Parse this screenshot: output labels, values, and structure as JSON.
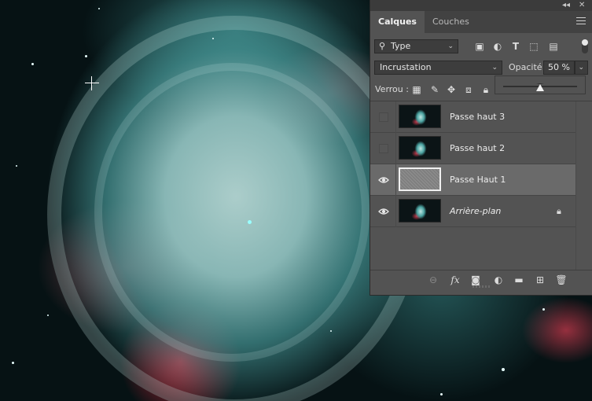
{
  "panel": {
    "topstrip": {
      "collapse_glyph": "◂◂",
      "close_glyph": "✕"
    },
    "tabs": [
      {
        "label": "Calques",
        "active": true
      },
      {
        "label": "Couches",
        "active": false
      }
    ],
    "filter": {
      "kind_label": "Type",
      "icons": [
        "image-filter-icon",
        "adjustment-filter-icon",
        "text-filter-icon",
        "shape-filter-icon",
        "smart-object-filter-icon"
      ]
    },
    "blend": {
      "mode": "Incrustation",
      "opacity_label": "Opacité :",
      "opacity_value": "50 %"
    },
    "lock": {
      "label": "Verrou :",
      "icons": [
        "lock-transparent-icon",
        "lock-image-icon",
        "lock-position-icon",
        "lock-artboard-icon",
        "lock-all-icon"
      ]
    },
    "opacity_slider": {
      "value_percent": 50
    },
    "layers": [
      {
        "name": "Passe haut 3",
        "visible": false,
        "selected": false,
        "thumb": "nebula",
        "locked": false,
        "italic": false
      },
      {
        "name": "Passe haut 2",
        "visible": false,
        "selected": false,
        "thumb": "nebula",
        "locked": false,
        "italic": false
      },
      {
        "name": "Passe Haut 1",
        "visible": true,
        "selected": true,
        "thumb": "highpass",
        "locked": false,
        "italic": false
      },
      {
        "name": "Arrière-plan",
        "visible": true,
        "selected": false,
        "thumb": "nebula",
        "locked": true,
        "italic": true
      }
    ],
    "bottom_icons": [
      "link-layers-icon",
      "fx-icon",
      "mask-icon",
      "adjustment-layer-icon",
      "group-folder-icon",
      "new-layer-icon",
      "trash-icon"
    ],
    "fx_label": "fx"
  },
  "colors": {
    "panel_bg": "#535353",
    "tab_bar_bg": "#424242",
    "selected_layer_bg": "#6a6a6a"
  }
}
